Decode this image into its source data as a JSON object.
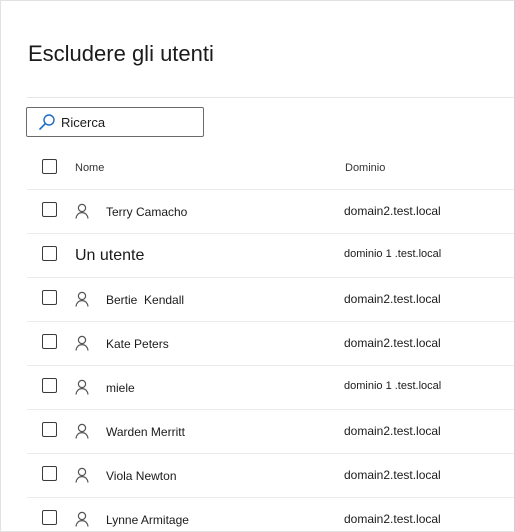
{
  "page": {
    "title": "Escludere gli utenti"
  },
  "search": {
    "icon": "search-icon",
    "value": "Ricerca"
  },
  "table": {
    "columns": {
      "name": "Nome",
      "domain": "Dominio"
    },
    "rows": [
      {
        "name": "Terry Camacho",
        "domain": "domain2.test.local",
        "icon": "person-icon"
      },
      {
        "name": "Un utente",
        "domain": "dominio 1 .test.local",
        "icon": ""
      },
      {
        "name": "Bertie  Kendall",
        "domain": "domain2.test.local",
        "icon": "person-icon"
      },
      {
        "name": "Kate Peters",
        "domain": "domain2.test.local",
        "icon": "person-icon"
      },
      {
        "name": "miele",
        "domain": "dominio 1 .test.local",
        "icon": "person-icon"
      },
      {
        "name": "Warden Merritt",
        "domain": "domain2.test.local",
        "icon": "person-icon"
      },
      {
        "name": "Viola Newton",
        "domain": "domain2.test.local",
        "icon": "person-icon"
      },
      {
        "name": "Lynne Armitage",
        "domain": "domain2.test.local",
        "icon": "person-icon"
      }
    ]
  }
}
